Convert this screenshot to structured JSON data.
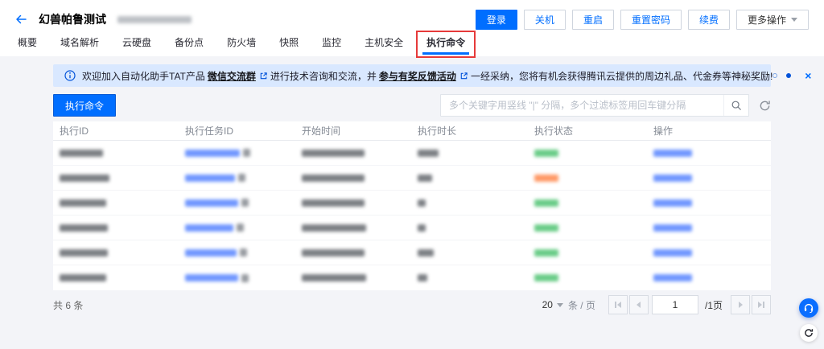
{
  "header": {
    "title": "幻兽帕鲁测试",
    "action_buttons": [
      "登录",
      "关机",
      "重启",
      "重置密码",
      "续费"
    ],
    "more_button": "更多操作"
  },
  "tabs": {
    "items": [
      "概要",
      "域名解析",
      "云硬盘",
      "备份点",
      "防火墙",
      "快照",
      "监控",
      "主机安全",
      "执行命令"
    ],
    "active": "执行命令"
  },
  "banner": {
    "text_part1": "欢迎加入自动化助手TAT产品",
    "link1": "微信交流群",
    "text_part2": "进行技术咨询和交流，并",
    "link2": "参与有奖反馈活动",
    "text_part3": "一经采纳，您将有机会获得腾讯云提供的周边礼品、代金券等神秘奖励!"
  },
  "toolbar": {
    "execute_button": "执行命令",
    "search_placeholder": "多个关键字用竖线 \"|\" 分隔，多个过滤标签用回车键分隔"
  },
  "table": {
    "columns": [
      "执行ID",
      "执行任务ID",
      "开始时间",
      "执行时长",
      "执行状态",
      "操作"
    ],
    "rows": [
      {
        "status_color": "green"
      },
      {
        "status_color": "orange"
      },
      {
        "status_color": "green"
      },
      {
        "status_color": "green"
      },
      {
        "status_color": "green"
      },
      {
        "status_color": "green"
      }
    ]
  },
  "pagination": {
    "total_text": "共 6 条",
    "page_size": "20",
    "unit_label": "条 / 页",
    "current_page": "1",
    "total_pages_label": "/1页"
  },
  "colors": {
    "accent_blue": "#006eff",
    "banner_link_blue": "#0052d9",
    "success_green": "#45c06a",
    "failed_orange": "#ff8040",
    "annotation_red": "#e63a3a",
    "banner_bg": "#d9e8ff"
  }
}
